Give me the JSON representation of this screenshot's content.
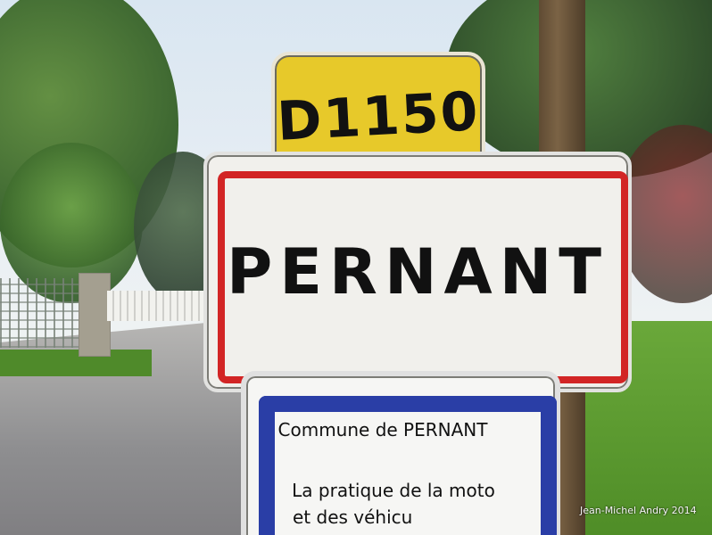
{
  "signs": {
    "route_number": "D1150",
    "town_name": "PERNANT",
    "blue_panel": {
      "title": "Commune de PERNANT",
      "line1": "La pratique de la moto",
      "line2": "et des véhicu"
    }
  },
  "credit": "Jean-Michel Andry 2014",
  "colors": {
    "route_sign_yellow": "#e7c92a",
    "town_sign_red_border": "#d22525",
    "panel_blue": "#2a3ea6"
  }
}
